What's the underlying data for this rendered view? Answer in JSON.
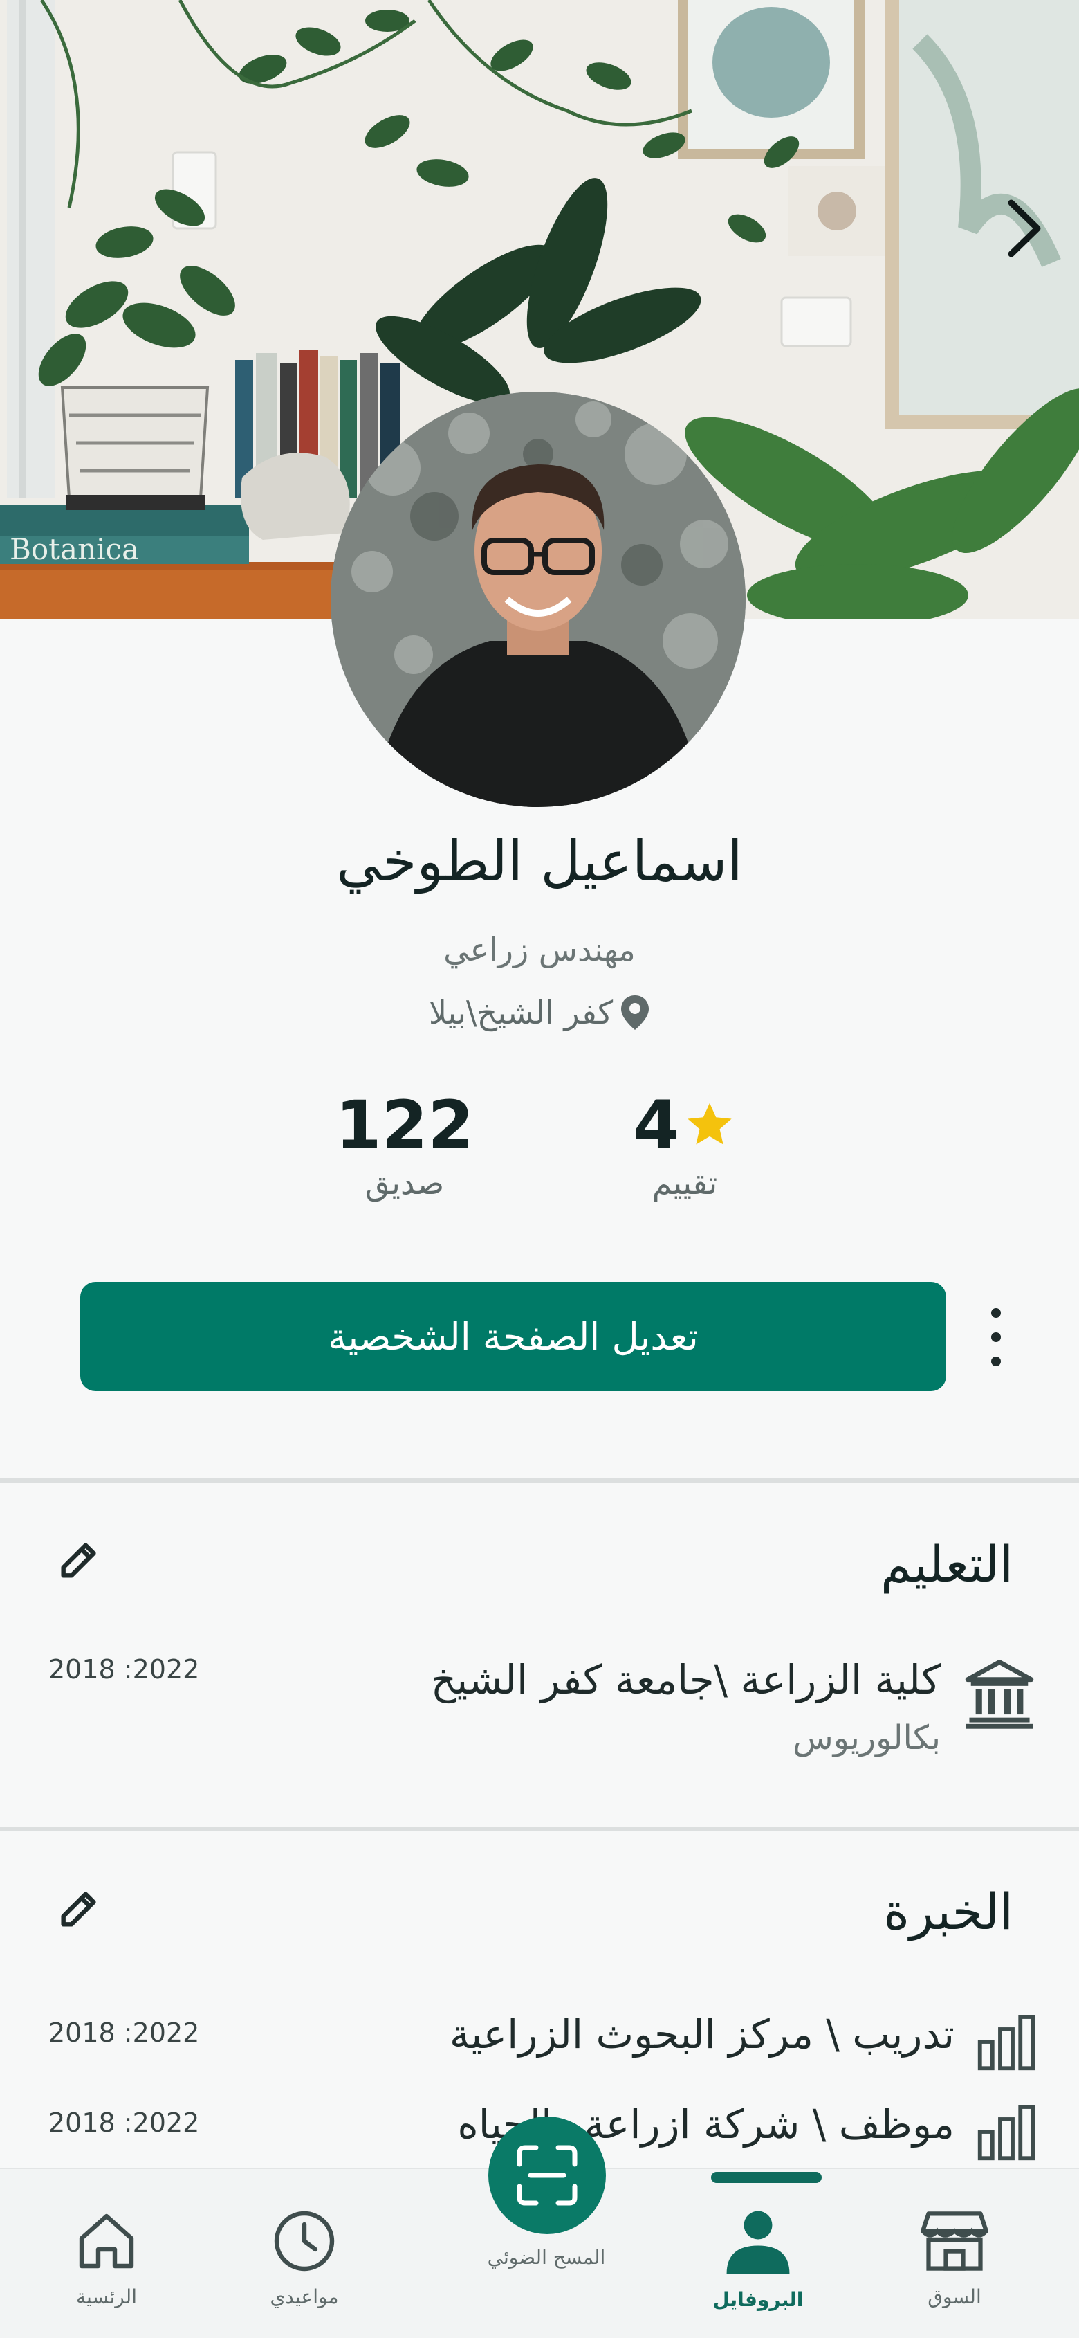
{
  "profile": {
    "name": "اسماعيل الطوخي",
    "job": "مهندس زراعي",
    "location": "كفر الشيخ\\بيلا"
  },
  "stats": {
    "friends_value": "122",
    "friends_label": "صديق",
    "rating_value": "4",
    "rating_label": "تقييم"
  },
  "actions": {
    "edit_profile_label": "تعديل الصفحة الشخصية"
  },
  "education": {
    "title": "التعليم",
    "items": [
      {
        "title": "كلية الزراعة \\جامعة كفر الشيخ",
        "subtitle": "بكالوريوس",
        "dates": "2018 :2022"
      }
    ]
  },
  "experience": {
    "title": "الخبرة",
    "items": [
      {
        "title": "تدريب \\ مركز البحوث الزراعية",
        "dates": "2018 :2022"
      },
      {
        "title": "موظف \\ شركة ازراعة والحياه",
        "dates": "2018 :2022"
      }
    ]
  },
  "cover": {
    "book_text": "Botanica"
  },
  "nav": {
    "market": "السوق",
    "profile": "البروفايل",
    "scan": "المسح الضوئي",
    "appointments": "مواعيدي",
    "home": "الرئسية"
  },
  "colors": {
    "primary": "#007a67",
    "star": "#f4c20d",
    "nav_active": "#0f6b5d"
  }
}
